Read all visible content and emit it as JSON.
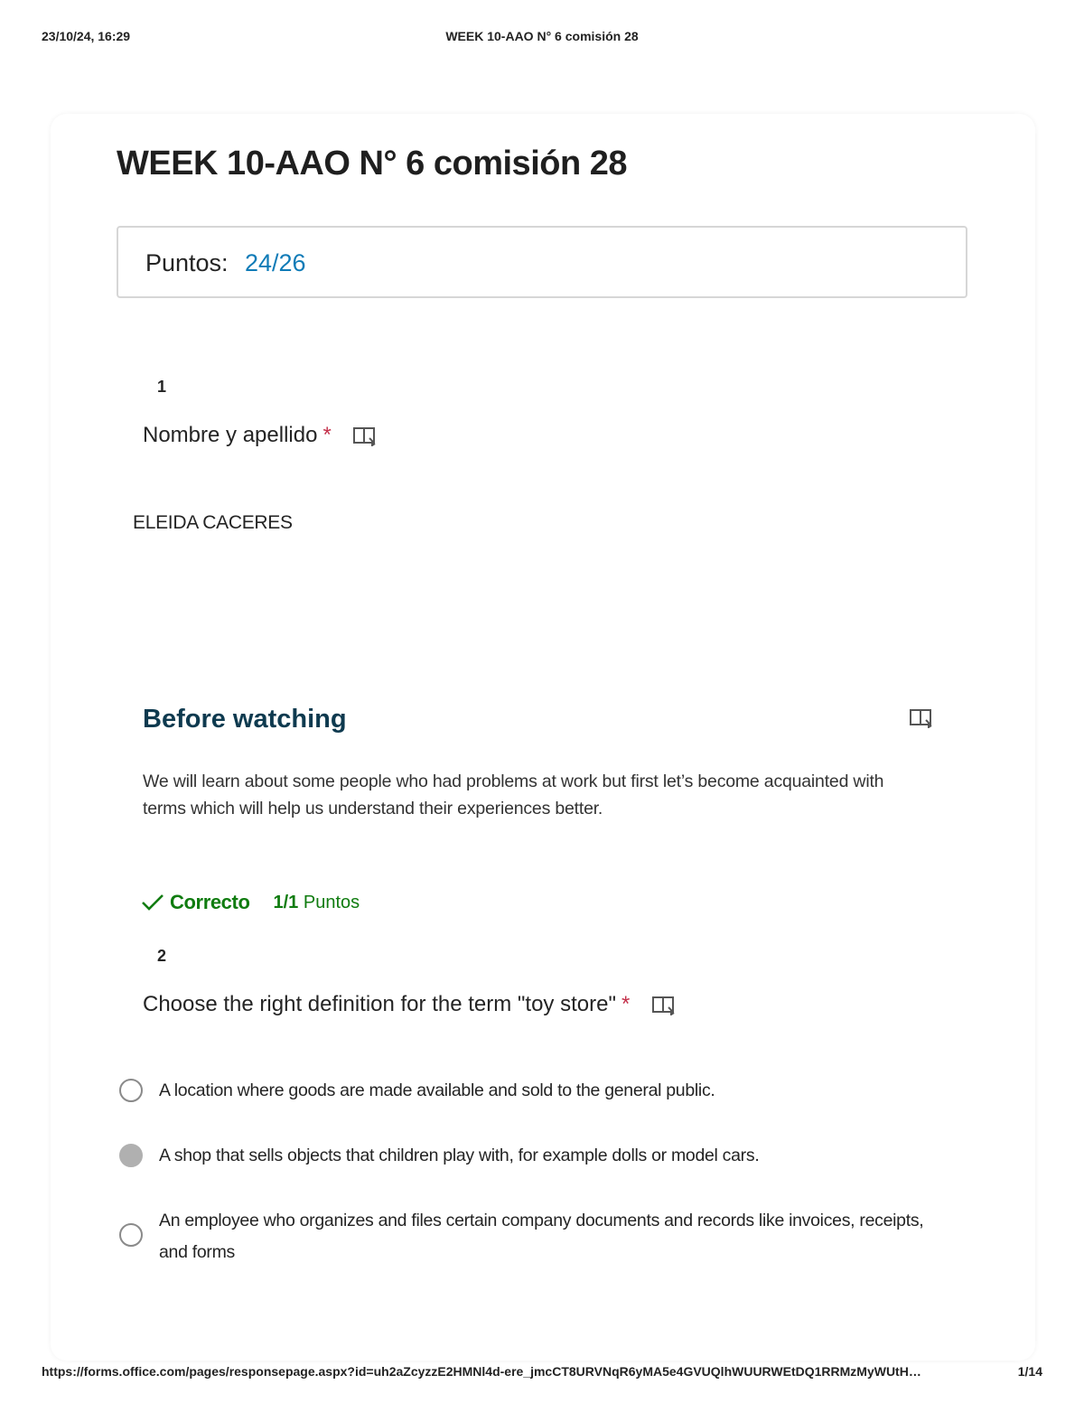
{
  "print_header": {
    "datetime": "23/10/24, 16:29",
    "title": "WEEK 10-AAO N° 6 comisión 28"
  },
  "form": {
    "title": "WEEK 10-AAO N° 6 comisión 28",
    "score_label": "Puntos:",
    "score_value": "24/26"
  },
  "questions": [
    {
      "number": "1",
      "title": "Nombre y apellido",
      "required_mark": "*",
      "answer": "ELEIDA CACERES"
    },
    {
      "number": "2",
      "title": "Choose the right definition for the term \"toy store\"",
      "required_mark": "*",
      "result_status": "Correcto",
      "result_points": "1/1",
      "result_points_label": "Puntos",
      "options": [
        {
          "text": "A location where goods are made available and sold to the general public.",
          "selected": false
        },
        {
          "text": "A shop that sells objects that children play with, for example dolls or model cars.",
          "selected": true
        },
        {
          "text": "An employee who organizes and files certain company documents and records like invoices, receipts, and forms",
          "selected": false
        }
      ]
    }
  ],
  "section": {
    "title": "Before watching",
    "description": "We will learn about some people who had problems at work but first let’s become acquainted with terms which will help us understand their experiences better."
  },
  "icons": {
    "reader": "immersive-reader-icon",
    "check": "checkmark-icon",
    "radio": "radio-button-icon"
  },
  "colors": {
    "score_accent": "#0f7bb7",
    "correct_green": "#107c10",
    "required_red": "#c4314b",
    "section_title": "#0e3a4f"
  },
  "print_footer": {
    "url": "https://forms.office.com/pages/responsepage.aspx?id=uh2aZcyzzE2HMNl4d-ere_jmcCT8URVNqR6yMA5e4GVUQlhWUURWEtDQ1RRMzMyWUtH…",
    "page": "1/14"
  }
}
